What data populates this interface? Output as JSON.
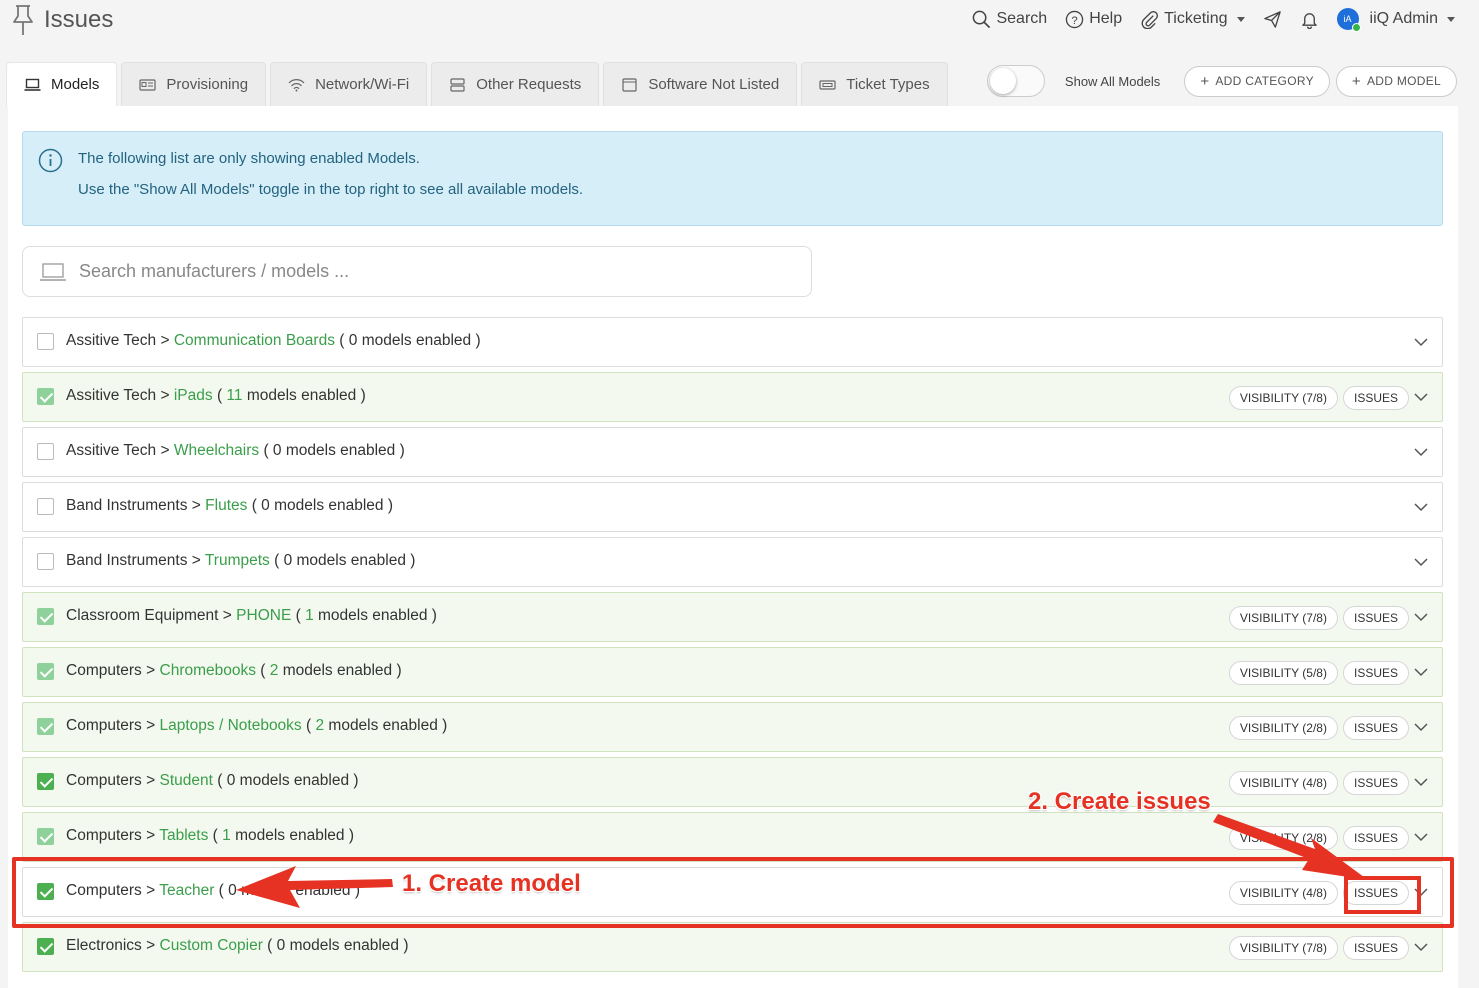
{
  "header": {
    "title": "Issues",
    "nav": {
      "search": "Search",
      "help": "Help",
      "ticketing": "Ticketing",
      "user_initials": "iA",
      "user_name": "iiQ Admin"
    }
  },
  "tabs": [
    {
      "label": "Models",
      "icon": "laptop-icon",
      "active": true
    },
    {
      "label": "Provisioning",
      "icon": "id-card-icon"
    },
    {
      "label": "Network/Wi-Fi",
      "icon": "wifi-icon"
    },
    {
      "label": "Other Requests",
      "icon": "server-icon"
    },
    {
      "label": "Software Not Listed",
      "icon": "window-icon"
    },
    {
      "label": "Ticket Types",
      "icon": "ticket-icon"
    }
  ],
  "toolbar": {
    "toggle_label": "Show All Models",
    "add_category": "ADD CATEGORY",
    "add_model": "ADD MODEL"
  },
  "info": {
    "line1": "The following list are only showing enabled Models.",
    "line2": "Use the \"Show All Models\" toggle in the top right to see all available models."
  },
  "search": {
    "placeholder": "Search manufacturers / models ..."
  },
  "categories": [
    {
      "category": "Assitive Tech",
      "sub": "Communication Boards",
      "count": "0",
      "enabled": false
    },
    {
      "category": "Assitive Tech",
      "sub": "iPads",
      "count": "11",
      "enabled": true,
      "visibility": "VISIBILITY (7/8)"
    },
    {
      "category": "Assitive Tech",
      "sub": "Wheelchairs",
      "count": "0",
      "enabled": false
    },
    {
      "category": "Band Instruments",
      "sub": "Flutes",
      "count": "0",
      "enabled": false
    },
    {
      "category": "Band Instruments",
      "sub": "Trumpets",
      "count": "0",
      "enabled": false
    },
    {
      "category": "Classroom Equipment",
      "sub": "PHONE",
      "count": "1",
      "enabled": true,
      "visibility": "VISIBILITY (7/8)"
    },
    {
      "category": "Computers",
      "sub": "Chromebooks",
      "count": "2",
      "enabled": true,
      "visibility": "VISIBILITY (5/8)"
    },
    {
      "category": "Computers",
      "sub": "Laptops / Notebooks",
      "count": "2",
      "enabled": true,
      "visibility": "VISIBILITY (2/8)"
    },
    {
      "category": "Computers",
      "sub": "Student",
      "count": "0",
      "enabled": true,
      "visibility": "VISIBILITY (4/8)"
    },
    {
      "category": "Computers",
      "sub": "Tablets",
      "count": "1",
      "enabled": true,
      "visibility": "VISIBILITY (2/8)"
    },
    {
      "category": "Computers",
      "sub": "Teacher",
      "count": "0",
      "enabled": true,
      "visibility": "VISIBILITY (4/8)"
    },
    {
      "category": "Electronics",
      "sub": "Custom Copier",
      "count": "0",
      "enabled": true,
      "visibility": "VISIBILITY (7/8)"
    }
  ],
  "labels": {
    "issues": "ISSUES",
    "separator": ">",
    "models_enabled": "models enabled"
  },
  "annotations": {
    "step1": "1. Create model",
    "step2": "2. Create issues"
  },
  "colors": {
    "accent_green": "#3a9e4a",
    "annotation_red": "#e53223",
    "info_bg": "#d6eef8"
  }
}
